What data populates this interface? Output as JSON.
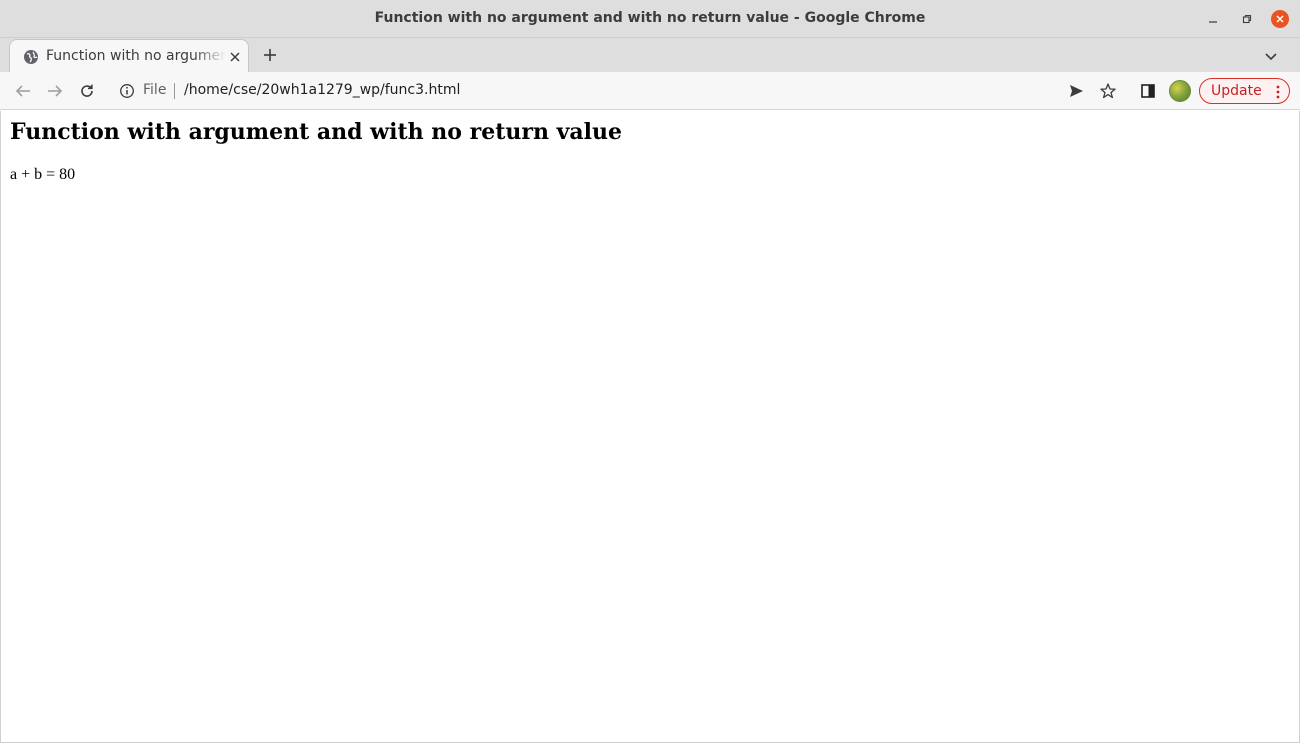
{
  "window": {
    "title": "Function with no argument and with no return value - Google Chrome",
    "controls": [
      "minimize-icon",
      "restore-icon",
      "close-icon"
    ],
    "close_color": "#e95420"
  },
  "tabs": [
    {
      "label": "Function with no argument and with no return value",
      "favicon": "globe-icon",
      "active": true
    }
  ],
  "toolbar": {
    "url_scheme": "File",
    "url_path": "/home/cse/20wh1a1279_wp/func3.html",
    "update_label": "Update",
    "update_color": "#c5221f"
  },
  "page": {
    "heading": "Function with argument and with no return value",
    "body_text": "a + b = 80"
  }
}
